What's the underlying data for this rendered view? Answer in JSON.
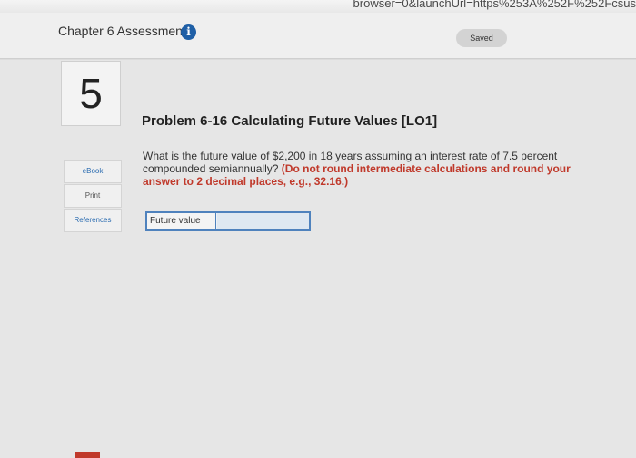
{
  "browser": {
    "url_visible": "browser=0&launchUrl=https%253A%252F%252Fcsus"
  },
  "header": {
    "chapter_title": "Chapter 6 Assessment",
    "info_icon_glyph": "i",
    "saved_label": "Saved"
  },
  "question": {
    "number": "5",
    "title": "Problem 6-16 Calculating Future Values [LO1]",
    "text": "What is the future value of $2,200 in 18 years assuming an interest rate of 7.5 percent compounded semiannually?",
    "instruction": "(Do not round intermediate calculations and round your answer to 2 decimal places, e.g., 32.16.)"
  },
  "sidebar": {
    "links": [
      {
        "label": "eBook"
      },
      {
        "label": "Print"
      },
      {
        "label": "References"
      }
    ]
  },
  "answer": {
    "label": "Future value",
    "value": "",
    "placeholder": ""
  },
  "colors": {
    "accent": "#1f5fa6",
    "instruction": "#c0392b",
    "input_border": "#4f82bd"
  }
}
